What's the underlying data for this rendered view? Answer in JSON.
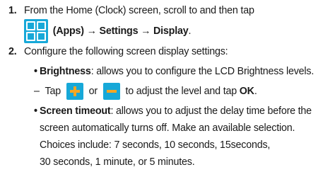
{
  "colors": {
    "text": "#1a1a1a",
    "icon_bg": "#17a8d8",
    "icon_symbol": "#f5a623"
  },
  "step1": {
    "number": "1.",
    "line1": "From the Home (Clock) screen, scroll to and then tap",
    "apps_icon": "apps-grid-icon",
    "apps_label": "(Apps)",
    "arrow1": "→",
    "settings": "Settings",
    "arrow2": "→",
    "display": "Display",
    "end": "."
  },
  "step2": {
    "number": "2.",
    "line1": "Configure the following screen display settings:",
    "brightness": {
      "bullet": "•",
      "term": "Brightness",
      "desc": ": allows you to configure the LCD Brightness levels.",
      "dash": "–",
      "tap": "Tap",
      "plus_icon": "plus-icon",
      "or": "or",
      "minus_icon": "minus-icon",
      "adjust": "to adjust the level and tap",
      "ok": "OK",
      "end": "."
    },
    "timeout": {
      "bullet": "•",
      "term": "Screen timeout",
      "desc": ": allows you to adjust the delay time before the",
      "line2": "screen automatically turns off. Make an available selection.",
      "line3": "Choices include: 7 seconds, 10 seconds, 15seconds,",
      "line4": "30 seconds, 1 minute, or 5 minutes."
    }
  }
}
